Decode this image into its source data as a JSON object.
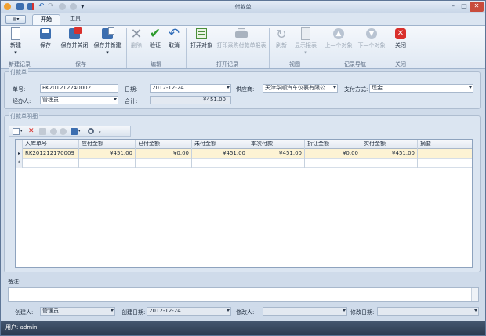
{
  "window": {
    "title": "付款单"
  },
  "tabs": {
    "app_menu": "▤▾",
    "home": "开始",
    "tools": "工具"
  },
  "ribbon": {
    "buttons": {
      "new": "新建",
      "save": "保存",
      "save_close": "保存并关闭",
      "save_new": "保存并新建",
      "delete": "删除",
      "verify": "验证",
      "cancel": "取消",
      "open_object": "打开对象",
      "print_related": "打印采购付款单报表",
      "refresh": "刷新",
      "print_report": "显示报表",
      "prev": "上一个对象",
      "next": "下一个对象",
      "close": "关闭"
    },
    "groups": {
      "new_record": "新建记录",
      "save": "保存",
      "edit": "编辑",
      "open_record": "打开记录",
      "view": "视图",
      "record_nav": "记录导航",
      "close": "关闭"
    }
  },
  "form": {
    "legend": "付款单",
    "doc_no_label": "单号:",
    "doc_no": "FK201212240002",
    "date_label": "日期:",
    "date": "2012-12-24",
    "supplier_label": "供应商:",
    "supplier": "天津华顺汽车仪表有限公...",
    "payment_method_label": "支付方式:",
    "payment_method": "现金",
    "handler_label": "经办人:",
    "handler": "管理员",
    "total_label": "合计:",
    "total": "¥451.00"
  },
  "detail": {
    "legend": "付款单明细",
    "columns": [
      "入库单号",
      "应付金额",
      "已付金额",
      "未付金额",
      "本次付款",
      "折让金额",
      "实付金额",
      "摘要"
    ],
    "rows": [
      {
        "marker": "▸",
        "cells": [
          "RK201212170009",
          "¥451.00",
          "¥0.00",
          "¥451.00",
          "¥451.00",
          "¥0.00",
          "¥451.00",
          ""
        ]
      },
      {
        "marker": "*",
        "cells": [
          "",
          "",
          "",
          "",
          "",
          "",
          "",
          ""
        ]
      }
    ]
  },
  "remarks": {
    "label": "备注:",
    "value": ""
  },
  "footer": {
    "creator_label": "创建人:",
    "creator": "管理员",
    "created_date_label": "创建日期:",
    "created_date": "2012-12-24",
    "modifier_label": "修改人:",
    "modifier": "",
    "modified_date_label": "修改日期:",
    "modified_date": ""
  },
  "status": {
    "user": "用户: admin"
  }
}
